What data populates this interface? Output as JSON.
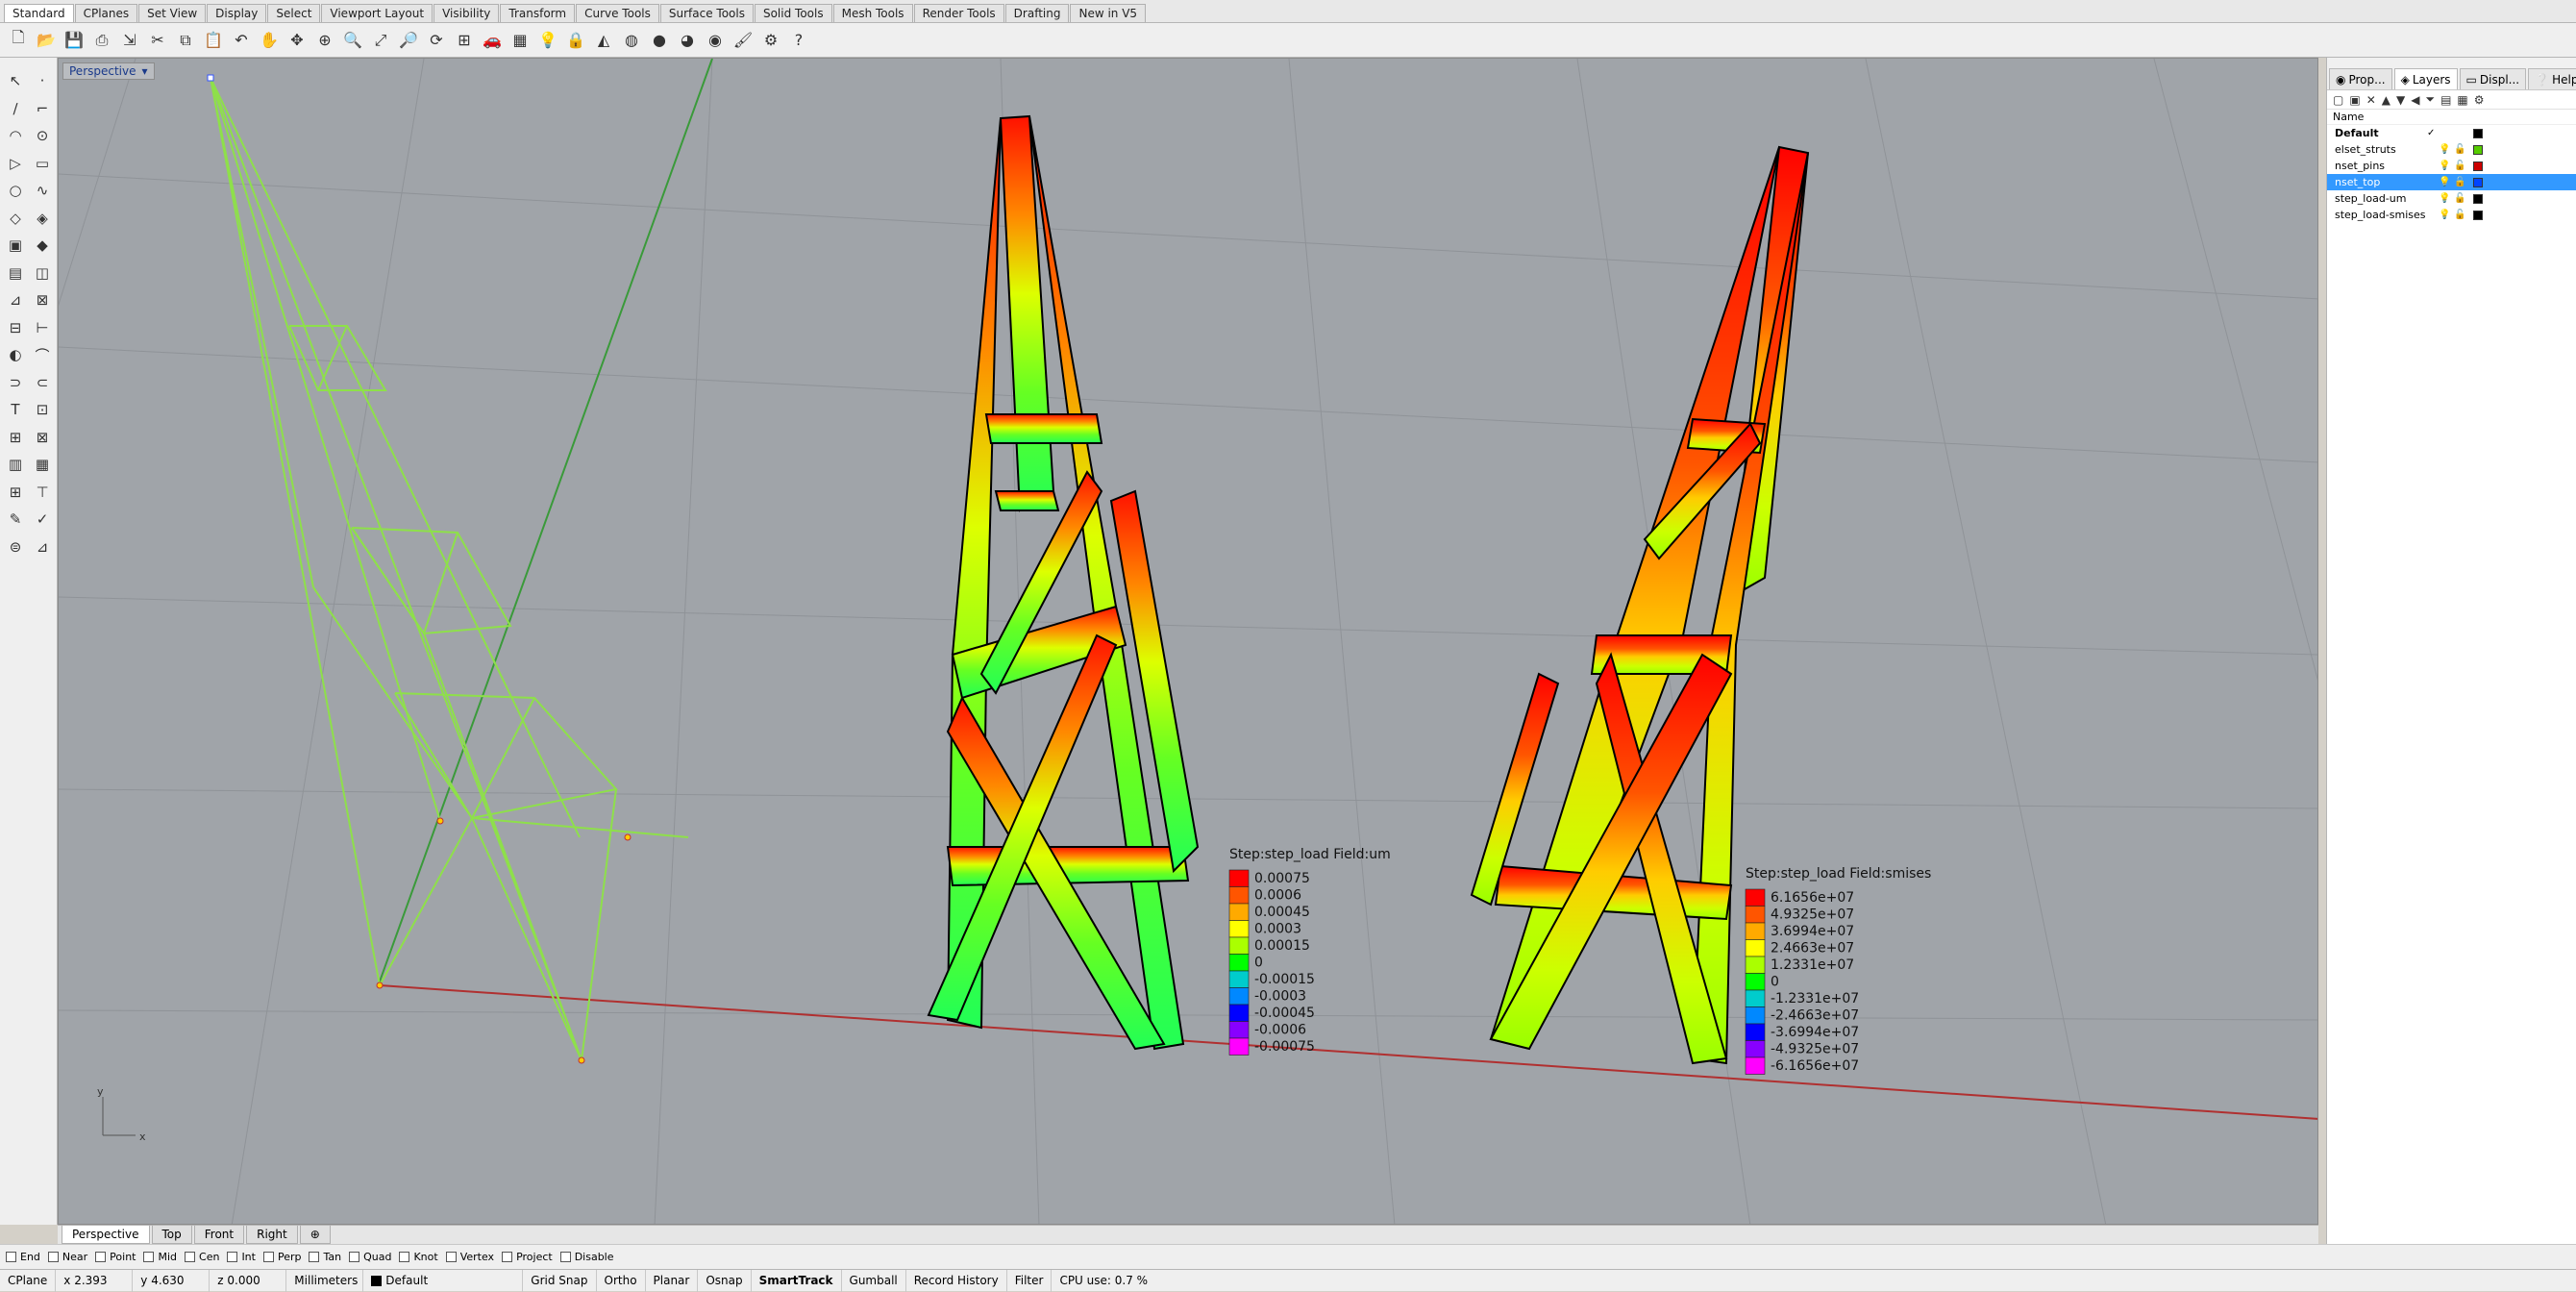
{
  "tabs": [
    "Standard",
    "CPlanes",
    "Set View",
    "Display",
    "Select",
    "Viewport Layout",
    "Visibility",
    "Transform",
    "Curve Tools",
    "Surface Tools",
    "Solid Tools",
    "Mesh Tools",
    "Render Tools",
    "Drafting",
    "New in V5"
  ],
  "active_tab": "Standard",
  "toolbar_icons": [
    "new-icon",
    "open-icon",
    "save-icon",
    "print-icon",
    "import-icon",
    "cut-icon",
    "copy-icon",
    "paste-icon",
    "undo-icon",
    "pan-icon",
    "move-icon",
    "zoom-window-icon",
    "zoom-dynamic-icon",
    "zoom-extents-icon",
    "zoom-selected-icon",
    "rotate-view-icon",
    "four-viewports-icon",
    "car-icon",
    "grid-icon",
    "lightbulb-icon",
    "lock-icon",
    "paint-icon",
    "color-wheel-icon",
    "shade-icon",
    "render-icon",
    "material-icon",
    "brush-icon",
    "settings-icon",
    "help-icon"
  ],
  "viewport": {
    "title": "Perspective",
    "dropdown_icon": "▾",
    "axis_x": "x",
    "axis_y": "y",
    "legend1": {
      "header": "Step:step_load   Field:um",
      "values": [
        "0.00075",
        "0.0006",
        "0.00045",
        "0.0003",
        "0.00015",
        "0",
        "-0.00015",
        "-0.0003",
        "-0.00045",
        "-0.0006",
        "-0.00075"
      ],
      "colors": [
        "#ff0000",
        "#ff5500",
        "#ffaa00",
        "#ffff00",
        "#aaff00",
        "#00ff00",
        "#00cccc",
        "#0088ff",
        "#0000ff",
        "#8800ff",
        "#ff00ff"
      ]
    },
    "legend2": {
      "header": "Step:step_load   Field:smises",
      "values": [
        "6.1656e+07",
        "4.9325e+07",
        "3.6994e+07",
        "2.4663e+07",
        "1.2331e+07",
        "0",
        "-1.2331e+07",
        "-2.4663e+07",
        "-3.6994e+07",
        "-4.9325e+07",
        "-6.1656e+07"
      ],
      "colors": [
        "#ff0000",
        "#ff5500",
        "#ffaa00",
        "#ffff00",
        "#aaff00",
        "#00ff00",
        "#00cccc",
        "#0088ff",
        "#0000ff",
        "#8800ff",
        "#ff00ff"
      ]
    }
  },
  "viewport_tabs": [
    "Perspective",
    "Top",
    "Front",
    "Right",
    "⊕"
  ],
  "panel": {
    "tabs": [
      "Prop...",
      "Layers",
      "Displ...",
      "Help"
    ],
    "tab_icons": [
      "◉",
      "◈",
      "▭",
      "❔"
    ],
    "header_name": "Name",
    "layers": [
      {
        "name": "Default",
        "bold": true,
        "check": "✓",
        "color": "#000000"
      },
      {
        "name": "elset_struts",
        "bold": false,
        "check": "",
        "color": "#55cc00"
      },
      {
        "name": "nset_pins",
        "bold": false,
        "check": "",
        "color": "#cc0000"
      },
      {
        "name": "nset_top",
        "bold": false,
        "check": "",
        "color": "#0044ff",
        "selected": true
      },
      {
        "name": "step_load-um",
        "bold": false,
        "check": "",
        "color": "#000000"
      },
      {
        "name": "step_load-smises",
        "bold": false,
        "check": "",
        "color": "#000000"
      }
    ],
    "tool_icons": [
      "▢",
      "▣",
      "✕",
      "▲",
      "▼",
      "◀",
      "⏷",
      "▤",
      "▦",
      "⚙"
    ]
  },
  "osnaps": [
    "End",
    "Near",
    "Point",
    "Mid",
    "Cen",
    "Int",
    "Perp",
    "Tan",
    "Quad",
    "Knot",
    "Vertex",
    "Project",
    "Disable"
  ],
  "status": {
    "cplane": "CPlane",
    "x": "x 2.393",
    "y": "y 4.630",
    "z": "z 0.000",
    "units": "Millimeters",
    "layer": "Default",
    "grid_snap": "Grid Snap",
    "ortho": "Ortho",
    "planar": "Planar",
    "osnap": "Osnap",
    "smarttrack": "SmartTrack",
    "gumball": "Gumball",
    "record_history": "Record History",
    "filter": "Filter",
    "cpu": "CPU use: 0.7 %"
  }
}
